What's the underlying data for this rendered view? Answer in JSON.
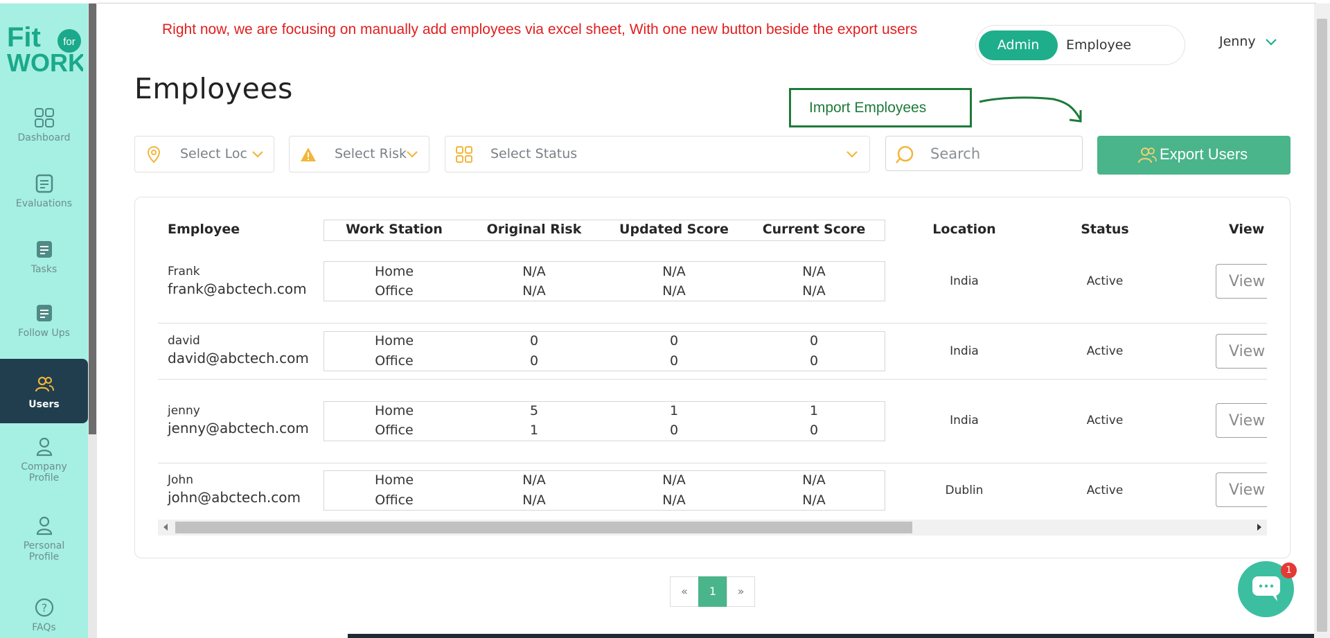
{
  "brand": {
    "logo_line1": "Fit",
    "logo_for": "for",
    "logo_line2": "WORK"
  },
  "sidebar": {
    "items": [
      {
        "label": "Dashboard",
        "icon": "grid-icon"
      },
      {
        "label": "Evaluations",
        "icon": "clipboard-icon"
      },
      {
        "label": "Tasks",
        "icon": "tasks-icon"
      },
      {
        "label": "Follow Ups",
        "icon": "followups-icon"
      },
      {
        "label": "Users",
        "icon": "users-icon",
        "active": true
      },
      {
        "label_line1": "Company",
        "label_line2": "Profile",
        "icon": "person-icon"
      },
      {
        "label_line1": "Personal",
        "label_line2": "Profile",
        "icon": "person-icon"
      },
      {
        "label": "FAQs",
        "icon": "question-icon"
      }
    ]
  },
  "annotation": {
    "note": "Right now, we are focusing on manually add employees via excel sheet, With one new button beside the export users",
    "box_label": "Import Employees"
  },
  "header": {
    "role_active": "Admin",
    "role_other": "Employee",
    "user_name": "Jenny"
  },
  "page": {
    "title": "Employees"
  },
  "filters": {
    "location": "Select Location",
    "risk": "Select Risk",
    "status": "Select Status",
    "search_placeholder": "Search",
    "export_label": "Export Users"
  },
  "table": {
    "headers": {
      "employee": "Employee",
      "work_station": "Work Station",
      "original_risk": "Original Risk",
      "updated_score": "Updated Score",
      "current_score": "Current Score",
      "location": "Location",
      "status": "Status",
      "view": "View"
    },
    "rows": [
      {
        "name": "Frank",
        "email": "frank@abctech.com",
        "ws1": "Home",
        "ws2": "Office",
        "or1": "N/A",
        "or2": "N/A",
        "us1": "N/A",
        "us2": "N/A",
        "cs1": "N/A",
        "cs2": "N/A",
        "location": "India",
        "status": "Active",
        "view": "View"
      },
      {
        "name": "david",
        "email": "david@abctech.com",
        "ws1": "Home",
        "ws2": "Office",
        "or1": "0",
        "or2": "0",
        "us1": "0",
        "us2": "0",
        "cs1": "0",
        "cs2": "0",
        "location": "India",
        "status": "Active",
        "view": "View"
      },
      {
        "name": "jenny",
        "email": "jenny@abctech.com",
        "ws1": "Home",
        "ws2": "Office",
        "or1": "5",
        "or2": "1",
        "us1": "1",
        "us2": "0",
        "cs1": "1",
        "cs2": "0",
        "location": "India",
        "status": "Active",
        "view": "View"
      },
      {
        "name": "John",
        "email": "john@abctech.com",
        "ws1": "Home",
        "ws2": "Office",
        "or1": "N/A",
        "or2": "N/A",
        "us1": "N/A",
        "us2": "N/A",
        "cs1": "N/A",
        "cs2": "N/A",
        "location": "Dublin",
        "status": "Active",
        "view": "View"
      }
    ]
  },
  "pagination": {
    "prev": "«",
    "current": "1",
    "next": "»"
  },
  "chat": {
    "badge": "1"
  },
  "colors": {
    "sidebar_bg": "#a6efe3",
    "active_nav": "#203e4d",
    "accent_green": "#4ab48b",
    "note_red": "#e01e1e",
    "annotation_green": "#1e7a3a"
  }
}
